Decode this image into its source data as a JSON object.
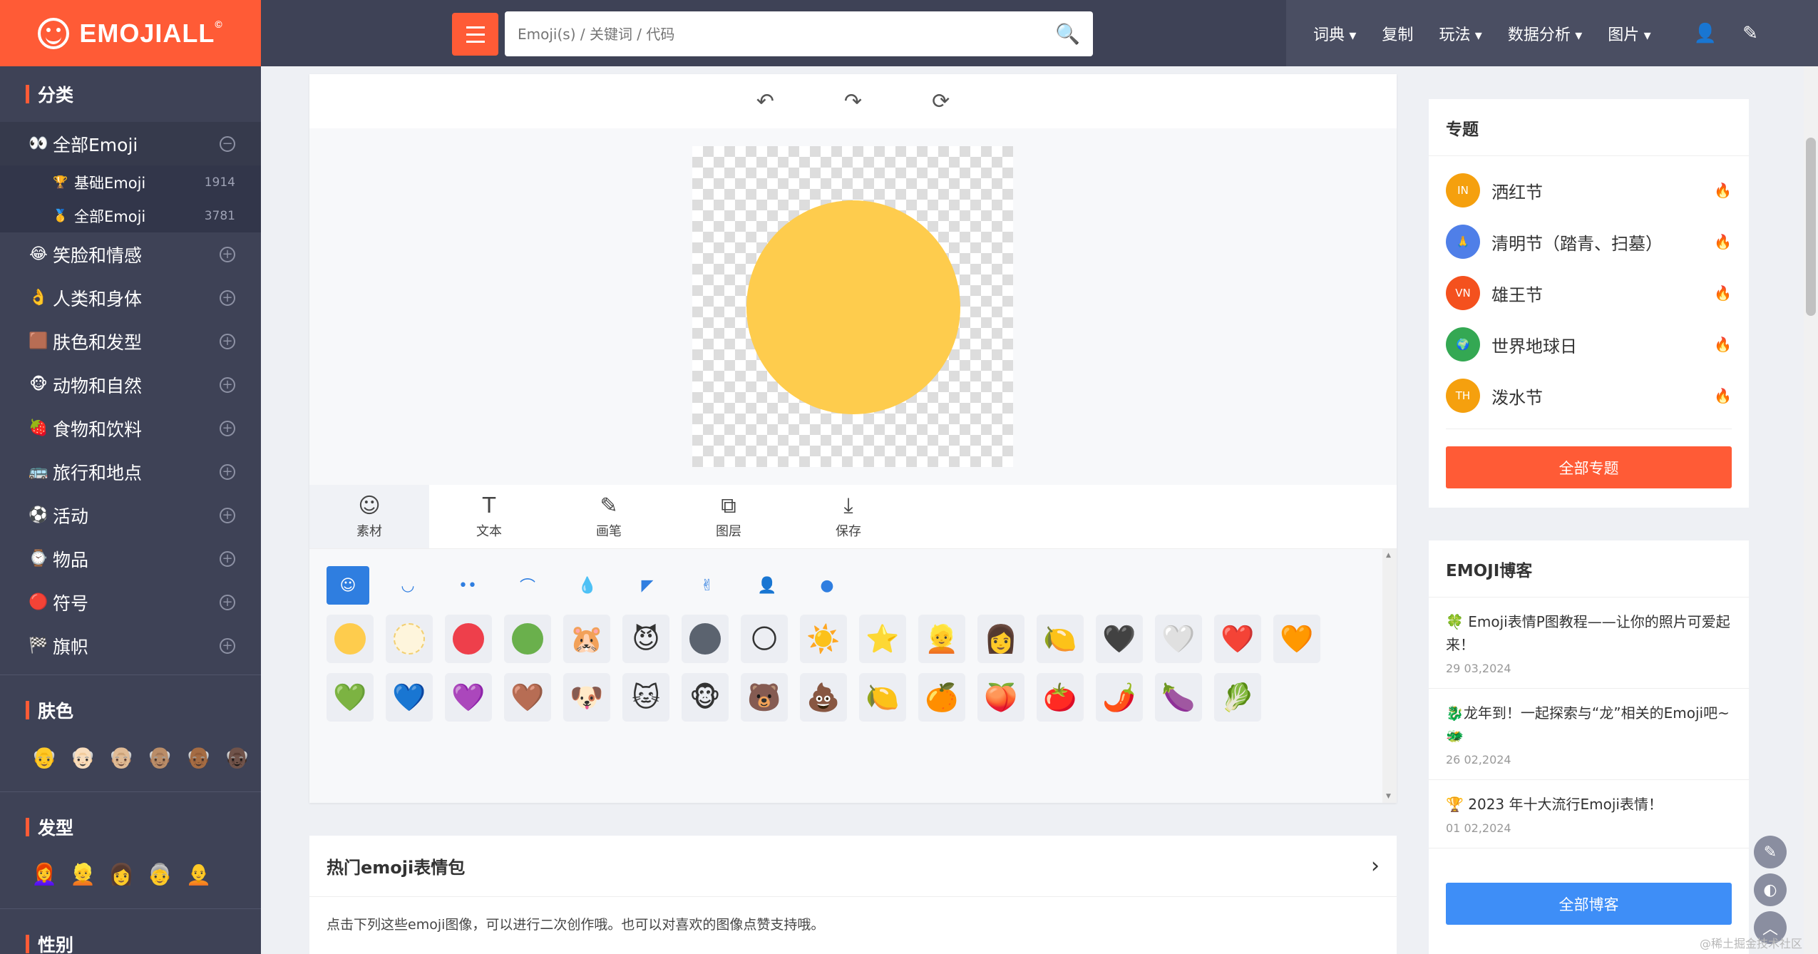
{
  "logo": {
    "text": "EMOJIALL",
    "mark": "©"
  },
  "sidebar": {
    "section_category": "分类",
    "all_emoji": {
      "label": "全部Emoji",
      "icon": "👀",
      "toggle": "−"
    },
    "sub_items": [
      {
        "icon": "🏆",
        "label": "基础Emoji",
        "count": "1914"
      },
      {
        "icon": "🥇",
        "label": "全部Emoji",
        "count": "3781"
      }
    ],
    "categories": [
      {
        "icon": "😂",
        "label": "笑脸和情感"
      },
      {
        "icon": "👌",
        "label": "人类和身体"
      },
      {
        "icon": "🟫",
        "label": "肤色和发型"
      },
      {
        "icon": "🐵",
        "label": "动物和自然"
      },
      {
        "icon": "🍓",
        "label": "食物和饮料"
      },
      {
        "icon": "🚌",
        "label": "旅行和地点"
      },
      {
        "icon": "⚽",
        "label": "活动"
      },
      {
        "icon": "⌚",
        "label": "物品"
      },
      {
        "icon": "🔴",
        "label": "符号"
      },
      {
        "icon": "🏁",
        "label": "旗帜"
      }
    ],
    "plus_symbol": "+",
    "section_skin": "肤色",
    "skin_tones": [
      "👴",
      "👴🏻",
      "👴🏼",
      "👴🏽",
      "👴🏾",
      "👴🏿"
    ],
    "section_hair": "发型",
    "hair_styles": [
      "👩‍🦰",
      "👱",
      "👩",
      "👵",
      "🧑‍🦲"
    ],
    "section_gender": "性别"
  },
  "header": {
    "search_placeholder": "Emoji(s) / 关键词 / 代码",
    "search_icon": "🔍",
    "nav": [
      {
        "label": "词典",
        "dropdown": true
      },
      {
        "label": "复制",
        "dropdown": false
      },
      {
        "label": "玩法",
        "dropdown": true
      },
      {
        "label": "数据分析",
        "dropdown": true
      },
      {
        "label": "图片",
        "dropdown": true
      }
    ],
    "user_icon": "👤",
    "edit_icon": "✎"
  },
  "editor": {
    "toolbar": {
      "undo": "↶",
      "redo": "↷",
      "reset": "⟳"
    },
    "canvas_color": "#fecc4d",
    "tabs": [
      {
        "icon": "☺",
        "label": "素材"
      },
      {
        "icon": "T",
        "label": "文本"
      },
      {
        "icon": "✎",
        "label": "画笔"
      },
      {
        "icon": "⧉",
        "label": "图层"
      },
      {
        "icon": "⤓",
        "label": "保存"
      }
    ],
    "part_icons": [
      "☺",
      "◡",
      "••",
      "⌒",
      "💧",
      "◤",
      "✌",
      "👤",
      "●"
    ],
    "materials": [
      {
        "type": "dot",
        "color": "#fecc4d"
      },
      {
        "type": "dot",
        "color": "#fef5dc",
        "border": "#f2cf70"
      },
      {
        "type": "dot",
        "color": "#ee3f4b"
      },
      {
        "type": "dot",
        "color": "#6ab04c"
      },
      {
        "type": "emoji",
        "glyph": "🐹"
      },
      {
        "type": "emoji",
        "glyph": "😈"
      },
      {
        "type": "dot",
        "color": "#5b636f"
      },
      {
        "type": "emoji",
        "glyph": "🌕"
      },
      {
        "type": "emoji",
        "glyph": "☀️"
      },
      {
        "type": "emoji",
        "glyph": "⭐"
      },
      {
        "type": "emoji",
        "glyph": "👱"
      },
      {
        "type": "emoji",
        "glyph": "👩"
      },
      {
        "type": "emoji",
        "glyph": "🍋"
      },
      {
        "type": "emoji",
        "glyph": "🖤"
      },
      {
        "type": "emoji",
        "glyph": "🤍"
      },
      {
        "type": "emoji",
        "glyph": "❤️"
      },
      {
        "type": "emoji",
        "glyph": "🧡"
      },
      {
        "type": "emoji",
        "glyph": "💚"
      },
      {
        "type": "emoji",
        "glyph": "💙"
      },
      {
        "type": "emoji",
        "glyph": "💜"
      },
      {
        "type": "emoji",
        "glyph": "🤎"
      },
      {
        "type": "emoji",
        "glyph": "🐶"
      },
      {
        "type": "emoji",
        "glyph": "🐱"
      },
      {
        "type": "emoji",
        "glyph": "🐵"
      },
      {
        "type": "emoji",
        "glyph": "🐻"
      },
      {
        "type": "emoji",
        "glyph": "💩"
      },
      {
        "type": "emoji",
        "glyph": "🍋"
      },
      {
        "type": "emoji",
        "glyph": "🍊"
      },
      {
        "type": "emoji",
        "glyph": "🍑"
      },
      {
        "type": "emoji",
        "glyph": "🍅"
      },
      {
        "type": "emoji",
        "glyph": "🌶️"
      },
      {
        "type": "emoji",
        "glyph": "🍆"
      },
      {
        "type": "emoji",
        "glyph": "🥬"
      }
    ]
  },
  "hot_packs": {
    "title": "热门emoji表情包",
    "arrow": "›",
    "desc": "点击下列这些emoji图像，可以进行二次创作哦。也可以对喜欢的图像点赞支持哦。"
  },
  "topics": {
    "title": "专题",
    "items": [
      {
        "badge": "IN",
        "color": "#f5a00e",
        "label": "洒红节"
      },
      {
        "badge": "🙏",
        "color": "#4f7fe8",
        "label": "清明节（踏青、扫墓）"
      },
      {
        "badge": "VN",
        "color": "#f4511e",
        "label": "雄王节"
      },
      {
        "badge": "🌍",
        "color": "#34a853",
        "label": "世界地球日"
      },
      {
        "badge": "TH",
        "color": "#f5a00e",
        "label": "泼水节"
      }
    ],
    "flame": "🔥",
    "all_button": "全部专题"
  },
  "blog": {
    "title": "EMOJI博客",
    "posts": [
      {
        "title": "🍀 Emoji表情P图教程——让你的照片可爱起来！",
        "date": "29 03,2024"
      },
      {
        "title": "🐉龙年到！一起探索与“龙”相关的Emoji吧~🐲",
        "date": "26 02,2024"
      },
      {
        "title": "🏆 2023 年十大流行Emoji表情！",
        "date": "01 02,2024"
      }
    ],
    "all_button": "全部博客"
  },
  "floating": {
    "edit": "✎",
    "theme": "◐",
    "top": "︿"
  },
  "watermark": "@稀土掘金技术社区"
}
